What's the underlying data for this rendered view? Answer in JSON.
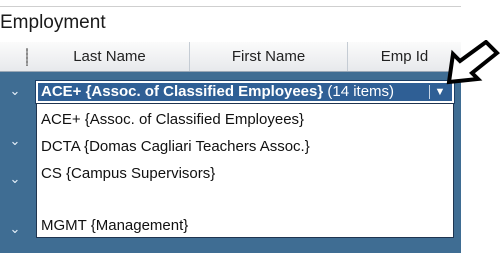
{
  "section_title": "Employment",
  "columns": [
    "Last Name",
    "First Name",
    "Emp Id"
  ],
  "combo": {
    "selected": "ACE+ {Assoc. of Classified Employees}",
    "count": "(14 items)"
  },
  "options": [
    "ACE+ {Assoc. of Classified Employees}",
    "DCTA {Domas Cagliari Teachers Assoc.}",
    "CS {Campus Supervisors}",
    "",
    "MGMT {Management}"
  ],
  "icons": {
    "row_expand": "chevron-down-icon",
    "combo_arrow": "dropdown-arrow-icon",
    "annotation": "pointer-arrow-icon"
  },
  "colors": {
    "grid_background": "#3f6d93",
    "combo_background": "#2f5f95",
    "header_background": "#eceef1"
  }
}
